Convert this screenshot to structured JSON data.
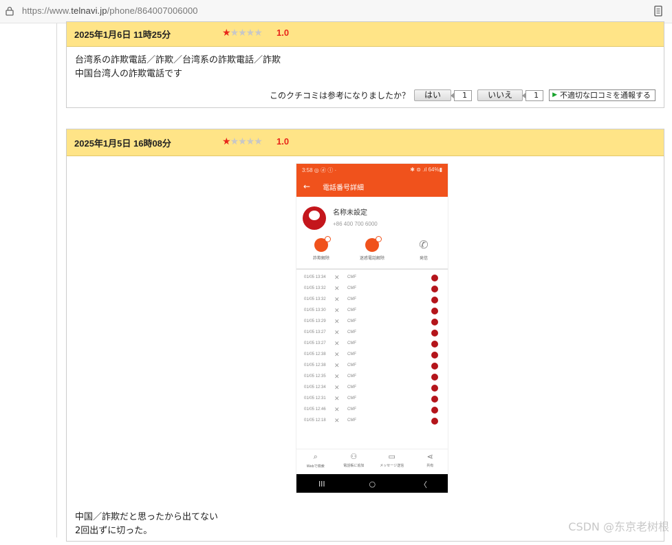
{
  "browser": {
    "url_prefix": "https://www.",
    "url_host": "telnavi.jp",
    "url_path": "/phone/864007006000"
  },
  "reviews": [
    {
      "date": "2025年1月6日 11時25分",
      "stars_filled": 1,
      "stars_total": 5,
      "score": "1.0",
      "lines": [
        "台湾系の詐欺電話／詐欺／台湾系の詐欺電話／詐欺",
        "中国台湾人の詐欺電話です"
      ],
      "vote": {
        "question": "このクチコミは参考になりましたか？",
        "yes_label": "はい",
        "yes_count": "1",
        "no_label": "いいえ",
        "no_count": "1",
        "report_label": "不適切な口コミを通報する"
      }
    },
    {
      "date": "2025年1月5日 16時08分",
      "stars_filled": 1,
      "stars_total": 5,
      "score": "1.0",
      "lines": [
        "中国／詐欺だと思ったから出てない",
        "2回出ずに切った。"
      ]
    }
  ],
  "phone_screenshot": {
    "status_left": "3:58 ◎ ⓓ ⓛ ·",
    "status_right": "✱ ⊜ .ıl 64%▮",
    "title": "電話番号詳細",
    "contact_name": "名称未設定",
    "contact_number": "+86 400 700 6000",
    "actions": [
      "詐欺解除",
      "迷惑電話解除",
      "発信"
    ],
    "log_label": "CMF",
    "log_times": [
      "01/05 13:34",
      "01/05 13:32",
      "01/05 13:32",
      "01/05 13:30",
      "01/05 13:29",
      "01/05 13:27",
      "01/05 13:27",
      "01/05 12:38",
      "01/05 12:38",
      "01/05 12:35",
      "01/05 12:34",
      "01/05 12:31",
      "01/05 12:46",
      "01/05 12:18"
    ],
    "bottom_nav": [
      "Webで検索",
      "電話帳に追加",
      "メッセージ送信",
      "共有"
    ],
    "sys_nav": [
      "III",
      "○",
      "〈"
    ]
  },
  "watermark": "CSDN @东京老树根"
}
